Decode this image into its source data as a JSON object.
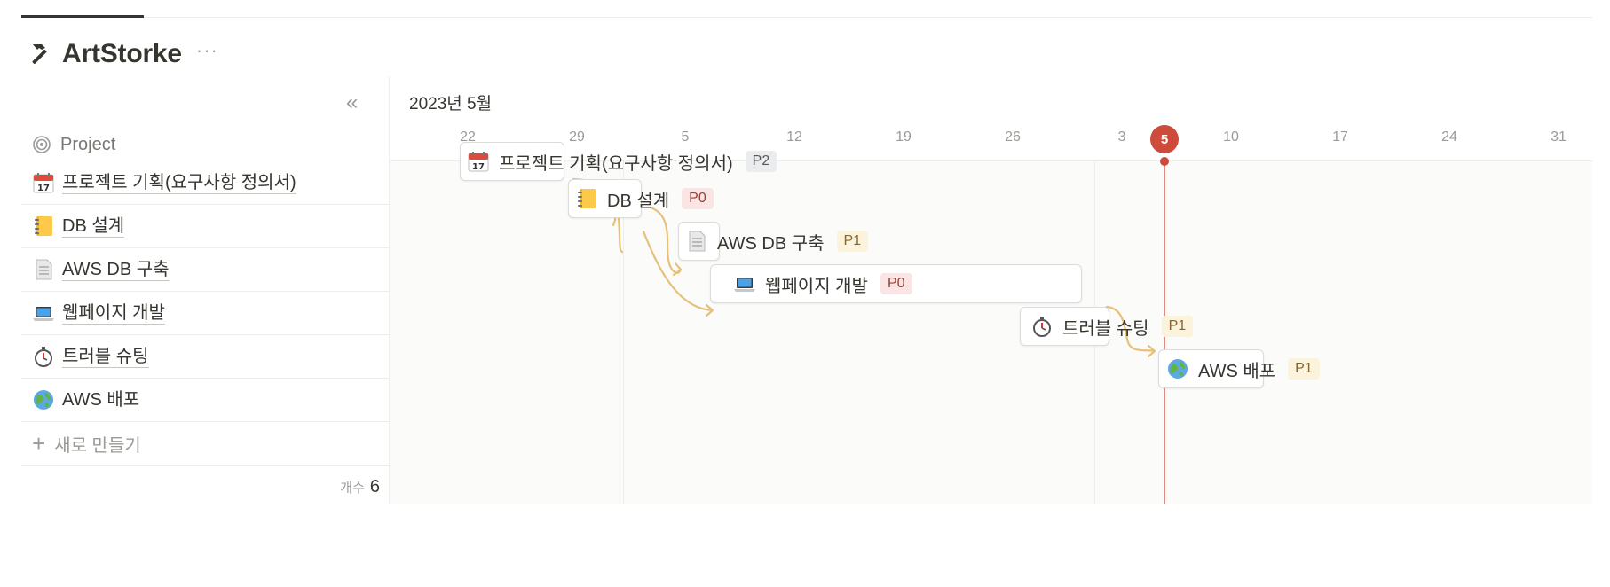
{
  "page": {
    "title": "ArtStorke",
    "title_icon": "hammer-icon",
    "more": "···"
  },
  "table": {
    "collapse": "«",
    "column_header": "Project",
    "rows": [
      {
        "icon": "calendar-icon",
        "label": "프로젝트 기획(요구사항 정의서)"
      },
      {
        "icon": "notebook-icon",
        "label": "DB 설계"
      },
      {
        "icon": "document-icon",
        "label": "AWS DB 구축"
      },
      {
        "icon": "laptop-icon",
        "label": "웹페이지 개발"
      },
      {
        "icon": "stopwatch-icon",
        "label": "트러블 슈팅"
      },
      {
        "icon": "globe-icon",
        "label": "AWS 배포"
      }
    ],
    "new_label": "새로 만들기",
    "count_label": "개수",
    "count_value": "6"
  },
  "timeline": {
    "month": "2023년 5월",
    "ticks": [
      "22",
      "29",
      "5",
      "12",
      "19",
      "26",
      "3",
      "5",
      "10",
      "17",
      "24",
      "31"
    ],
    "today": "5",
    "bars": [
      {
        "label": "프로젝트 기획(요구사항 정의서)",
        "icon": "calendar-icon",
        "tag": "P2"
      },
      {
        "label": "DB 설계",
        "icon": "notebook-icon",
        "tag": "P0"
      },
      {
        "label": "AWS DB 구축",
        "icon": "document-icon",
        "tag": "P1"
      },
      {
        "label": "웹페이지 개발",
        "icon": "laptop-icon",
        "tag": "P0"
      },
      {
        "label": "트러블 슈팅",
        "icon": "stopwatch-icon",
        "tag": "P1"
      },
      {
        "label": "AWS 배포",
        "icon": "globe-icon",
        "tag": "P1"
      }
    ]
  },
  "colors": {
    "tag_P0_bg": "#fbe4e4",
    "tag_P0_fg": "#93413a",
    "tag_P1_bg": "#fbf3db",
    "tag_P1_fg": "#89632a",
    "tag_P2_bg": "#ebeced",
    "tag_P2_fg": "#5a5a5a",
    "today": "#cd4b3a",
    "dependency": "#e6c17a"
  }
}
